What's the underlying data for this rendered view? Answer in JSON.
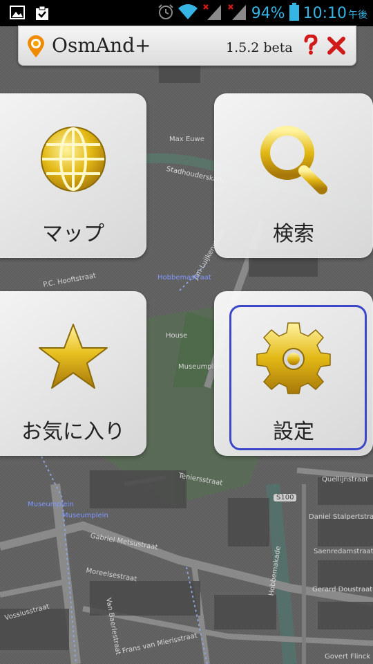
{
  "status_bar": {
    "battery_percent": "94%",
    "time": "10:10",
    "ampm": "午後",
    "icons": [
      "image-icon",
      "clipboard-check-icon",
      "alarm-icon",
      "wifi-icon",
      "signal-no-data-icon",
      "signal-no-data-icon",
      "battery-icon"
    ]
  },
  "app": {
    "title": "OsmAnd+",
    "version": "1.5.2 beta"
  },
  "menu": {
    "map": {
      "label": "マップ",
      "icon": "globe-icon"
    },
    "search": {
      "label": "検索",
      "icon": "magnifier-icon"
    },
    "favorites": {
      "label": "お気に入り",
      "icon": "star-icon"
    },
    "settings": {
      "label": "設定",
      "icon": "gear-icon"
    }
  },
  "map_labels": {
    "l1": "Max Euwe",
    "l2": "Stadhouderskade",
    "l3": "Jan Luijkenstraat",
    "l4": "P.C. Hooftstraat",
    "l5": "Hobbemastraat",
    "l6": "Museumplein",
    "l7": "Museumplein",
    "l8": "Museumplein",
    "l9": "Teniersstraat",
    "l10": "Gabriel Metsustraat",
    "l11": "Moreelsestraat",
    "l12": "Vossiusstraat",
    "l13": "Frans van Mierisstraat",
    "l14": "Quellijnstraat",
    "l15": "Daniel Stalpertstraat",
    "l16": "Saenredamstraat",
    "l17": "Gerard Doustraat",
    "l18": "Hobbemakade",
    "l19": "Govert Flinck",
    "l20": "S100",
    "l21": "House",
    "l22": "Van Baerlestraat"
  },
  "colors": {
    "statusbar_text": "#36b5e5",
    "focus_ring": "#3b46c9",
    "icon_gold": "#e2b814",
    "close_red": "#d11a1a"
  }
}
